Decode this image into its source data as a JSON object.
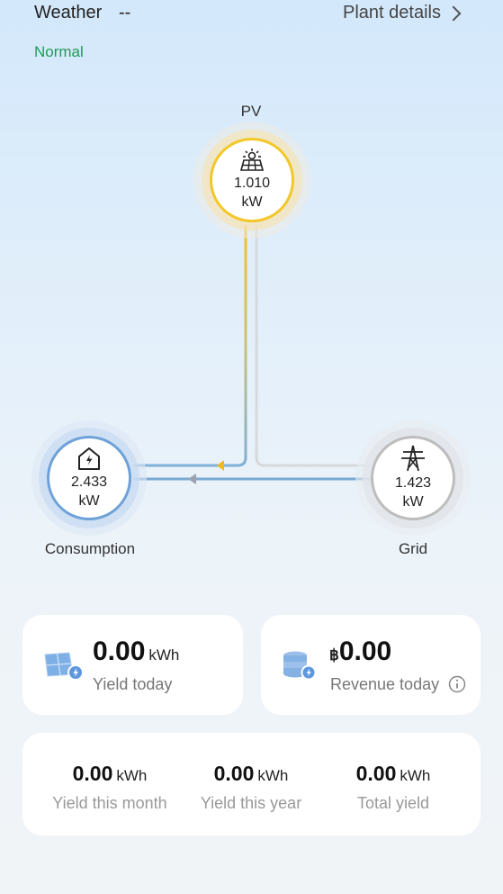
{
  "header": {
    "weather_label": "Weather",
    "weather_value": "--",
    "plant_details_label": "Plant details",
    "status": "Normal"
  },
  "flow": {
    "pv": {
      "label": "PV",
      "value": "1.010",
      "unit": "kW"
    },
    "consumption": {
      "label": "Consumption",
      "value": "2.433",
      "unit": "kW"
    },
    "grid": {
      "label": "Grid",
      "value": "1.423",
      "unit": "kW"
    }
  },
  "yield_today": {
    "value": "0.00",
    "unit": "kWh",
    "caption": "Yield today"
  },
  "revenue_today": {
    "currency": "฿",
    "value": "0.00",
    "caption": "Revenue today"
  },
  "summary": [
    {
      "value": "0.00",
      "unit": "kWh",
      "caption": "Yield this month"
    },
    {
      "value": "0.00",
      "unit": "kWh",
      "caption": "Yield this year"
    },
    {
      "value": "0.00",
      "unit": "kWh",
      "caption": "Total yield"
    }
  ],
  "colors": {
    "status_green": "#1f9a57",
    "pv_accent": "#f3c728",
    "consumption_accent": "#6fa2d8",
    "grid_accent": "#bdbdbd"
  }
}
